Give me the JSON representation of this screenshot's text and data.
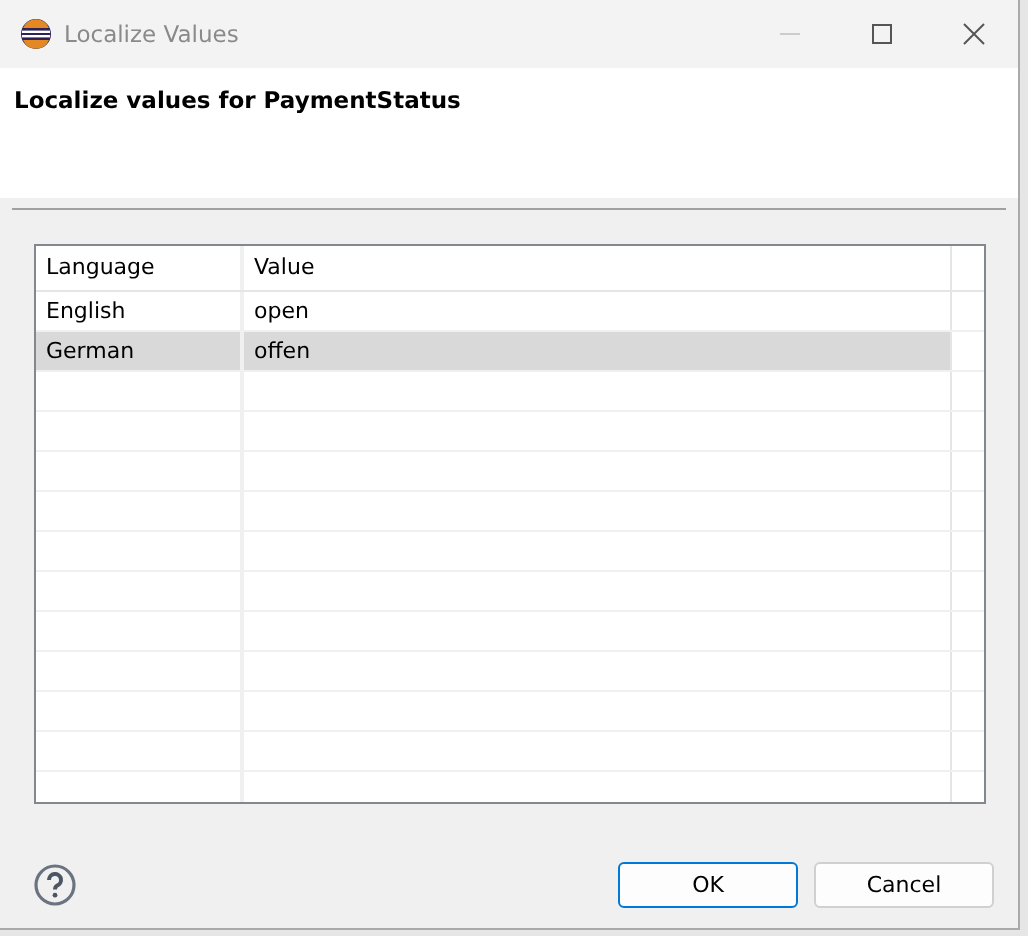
{
  "window": {
    "title": "Localize Values"
  },
  "header": {
    "title": "Localize values for PaymentStatus"
  },
  "table": {
    "columns": [
      "Language",
      "Value"
    ],
    "rows": [
      {
        "cells": [
          "English",
          "open"
        ],
        "selected": false
      },
      {
        "cells": [
          "German",
          "offen"
        ],
        "selected": true
      }
    ]
  },
  "buttons": [
    {
      "label": "OK",
      "kind": "default"
    },
    {
      "label": "Cancel",
      "kind": "normal"
    }
  ]
}
